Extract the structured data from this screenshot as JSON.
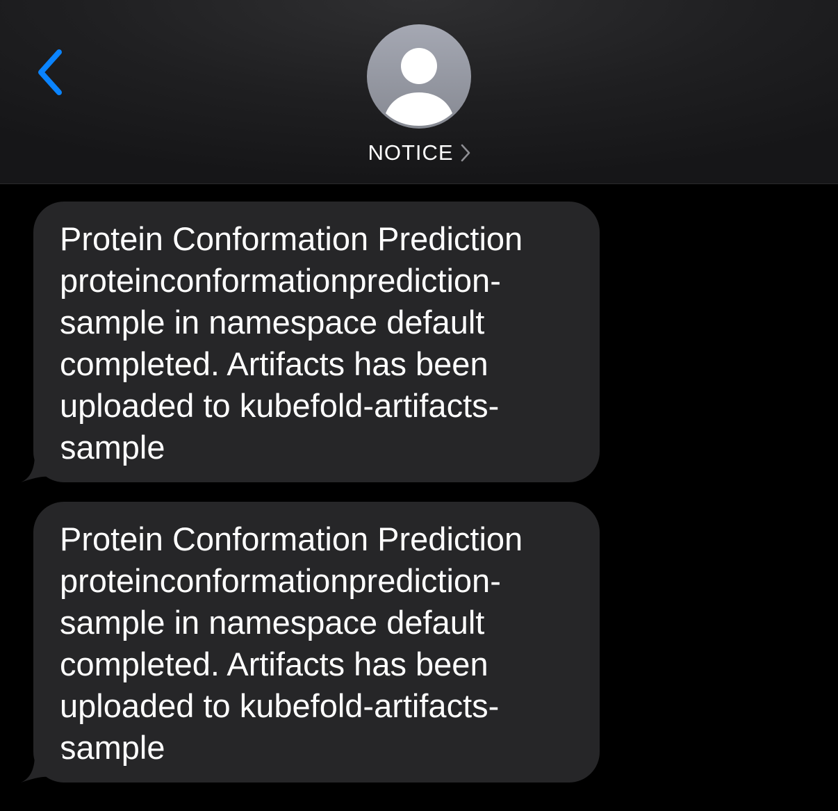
{
  "header": {
    "contact_name": "NOTICE",
    "icons": {
      "back": "chevron-left-icon",
      "avatar": "person-silhouette-icon",
      "details": "chevron-right-icon"
    },
    "colors": {
      "accent": "#0a84ff",
      "bubble": "#262628",
      "background": "#000000"
    }
  },
  "messages": [
    {
      "lines": [
        "Protein Conformation Prediction",
        "proteinconformationprediction-",
        "sample in namespace default",
        "completed. Artifacts has been",
        "uploaded to kubefold-artifacts-",
        "sample"
      ]
    },
    {
      "lines": [
        "Protein Conformation Prediction",
        "proteinconformationprediction-",
        "sample in namespace default",
        "completed. Artifacts has been",
        "uploaded to kubefold-artifacts-",
        "sample"
      ]
    }
  ]
}
